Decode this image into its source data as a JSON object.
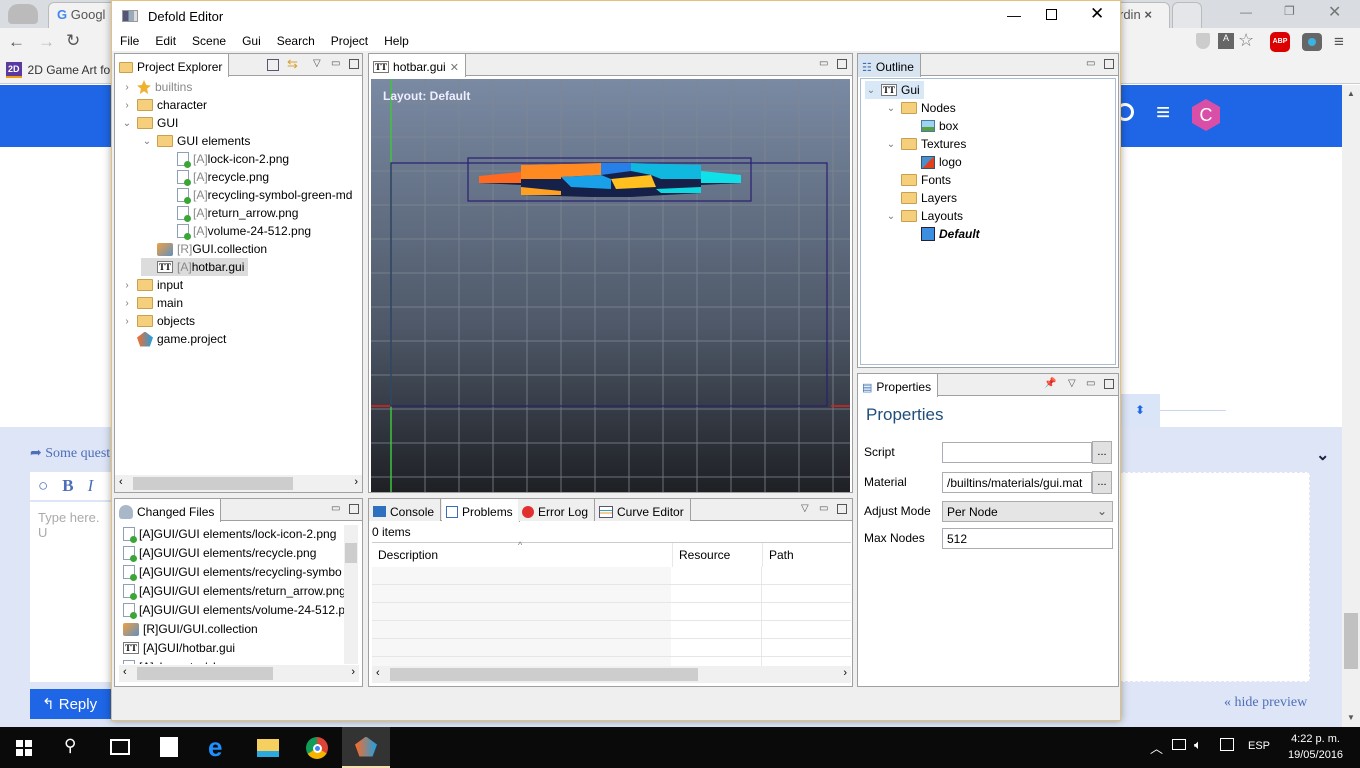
{
  "browser": {
    "tabs": [
      {
        "label": "Googl"
      },
      {
        "label": "rdin"
      }
    ],
    "bookmark": {
      "badge": "2D",
      "label": "2D Game Art fo"
    },
    "ext_icons": [
      "shield-icon",
      "translate-icon",
      "star-icon",
      "adblock-icon",
      "eye-icon",
      "menu-icon"
    ],
    "abp_label": "ABP",
    "avatar_letter": "C",
    "reply_hint": "Some quest",
    "editor_placeholder": "Type here. U",
    "bold": "B",
    "italic": "I",
    "reply_button": "Reply",
    "hide_preview": "« hide preview",
    "colors": {
      "header": "#1e66e6",
      "reply_bg": "#dde5f6",
      "avatar": "#d94fa8"
    }
  },
  "window": {
    "title": "Defold Editor",
    "menu": [
      "File",
      "Edit",
      "Scene",
      "Gui",
      "Search",
      "Project",
      "Help"
    ]
  },
  "project_explorer": {
    "tab": "Project Explorer",
    "items": [
      {
        "label": "builtins",
        "prefix": "",
        "depth": 0,
        "chev": "›",
        "type": "builtins"
      },
      {
        "label": "character",
        "prefix": "",
        "depth": 0,
        "chev": "›",
        "type": "folder"
      },
      {
        "label": "GUI",
        "prefix": "",
        "depth": 0,
        "chev": "⌄",
        "type": "folder"
      },
      {
        "label": "GUI elements",
        "prefix": "",
        "depth": 1,
        "chev": "⌄",
        "type": "folder"
      },
      {
        "label": "lock-icon-2.png",
        "prefix": "[A]",
        "depth": 2,
        "chev": "",
        "type": "file"
      },
      {
        "label": "recycle.png",
        "prefix": "[A]",
        "depth": 2,
        "chev": "",
        "type": "file"
      },
      {
        "label": "recycling-symbol-green-md",
        "prefix": "[A]",
        "depth": 2,
        "chev": "",
        "type": "file"
      },
      {
        "label": "return_arrow.png",
        "prefix": "[A]",
        "depth": 2,
        "chev": "",
        "type": "file"
      },
      {
        "label": "volume-24-512.png",
        "prefix": "[A]",
        "depth": 2,
        "chev": "",
        "type": "file"
      },
      {
        "label": "GUI.collection",
        "prefix": "[R]",
        "depth": 1,
        "chev": "",
        "type": "collection"
      },
      {
        "label": "hotbar.gui",
        "prefix": "[A]",
        "depth": 1,
        "chev": "",
        "type": "gui",
        "selected": true
      },
      {
        "label": "input",
        "prefix": "",
        "depth": 0,
        "chev": "›",
        "type": "folder"
      },
      {
        "label": "main",
        "prefix": "",
        "depth": 0,
        "chev": "›",
        "type": "folder"
      },
      {
        "label": "objects",
        "prefix": "",
        "depth": 0,
        "chev": "›",
        "type": "folder"
      },
      {
        "label": "game.project",
        "prefix": "",
        "depth": 0,
        "chev": "",
        "type": "project"
      }
    ]
  },
  "changed_files": {
    "tab": "Changed Files",
    "items": [
      {
        "label": "[A]GUI/GUI elements/lock-icon-2.png",
        "type": "file"
      },
      {
        "label": "[A]GUI/GUI elements/recycle.png",
        "type": "file"
      },
      {
        "label": "[A]GUI/GUI elements/recycling-symbo",
        "type": "file"
      },
      {
        "label": "[A]GUI/GUI elements/return_arrow.png",
        "type": "file"
      },
      {
        "label": "[A]GUI/GUI elements/volume-24-512.p",
        "type": "file"
      },
      {
        "label": "[R]GUI/GUI.collection",
        "type": "collection"
      },
      {
        "label": "[A]GUI/hotbar.gui",
        "type": "gui"
      },
      {
        "label": "[A]character/ch",
        "type": "file"
      }
    ]
  },
  "editor": {
    "tab": "hotbar.gui",
    "layout_label": "Layout: Default"
  },
  "bottom": {
    "tabs": [
      "Console",
      "Problems",
      "Error Log",
      "Curve Editor"
    ],
    "active_tab": "Problems",
    "count": "0 items",
    "columns": [
      "Description",
      "Resource",
      "Path"
    ]
  },
  "outline": {
    "tab": "Outline",
    "items": [
      {
        "label": "Gui",
        "depth": 0,
        "chev": "⌄",
        "type": "gui"
      },
      {
        "label": "Nodes",
        "depth": 1,
        "chev": "⌄",
        "type": "folder"
      },
      {
        "label": "box",
        "depth": 2,
        "chev": "",
        "type": "box"
      },
      {
        "label": "Textures",
        "depth": 1,
        "chev": "⌄",
        "type": "folder"
      },
      {
        "label": "logo",
        "depth": 2,
        "chev": "",
        "type": "texture"
      },
      {
        "label": "Fonts",
        "depth": 1,
        "chev": "",
        "type": "folder"
      },
      {
        "label": "Layers",
        "depth": 1,
        "chev": "",
        "type": "folder"
      },
      {
        "label": "Layouts",
        "depth": 1,
        "chev": "⌄",
        "type": "folder"
      },
      {
        "label": "Default",
        "depth": 2,
        "chev": "",
        "type": "layout"
      }
    ]
  },
  "properties": {
    "tab": "Properties",
    "heading": "Properties",
    "script_label": "Script",
    "script_value": "",
    "material_label": "Material",
    "material_value": "/builtins/materials/gui.mat",
    "adjust_label": "Adjust  Mode",
    "adjust_value": "Per Node",
    "max_label": "Max  Nodes",
    "max_value": "512",
    "browse": "..."
  },
  "taskbar": {
    "lang": "ESP",
    "time": "4:22 p. m.",
    "date": "19/05/2016"
  }
}
